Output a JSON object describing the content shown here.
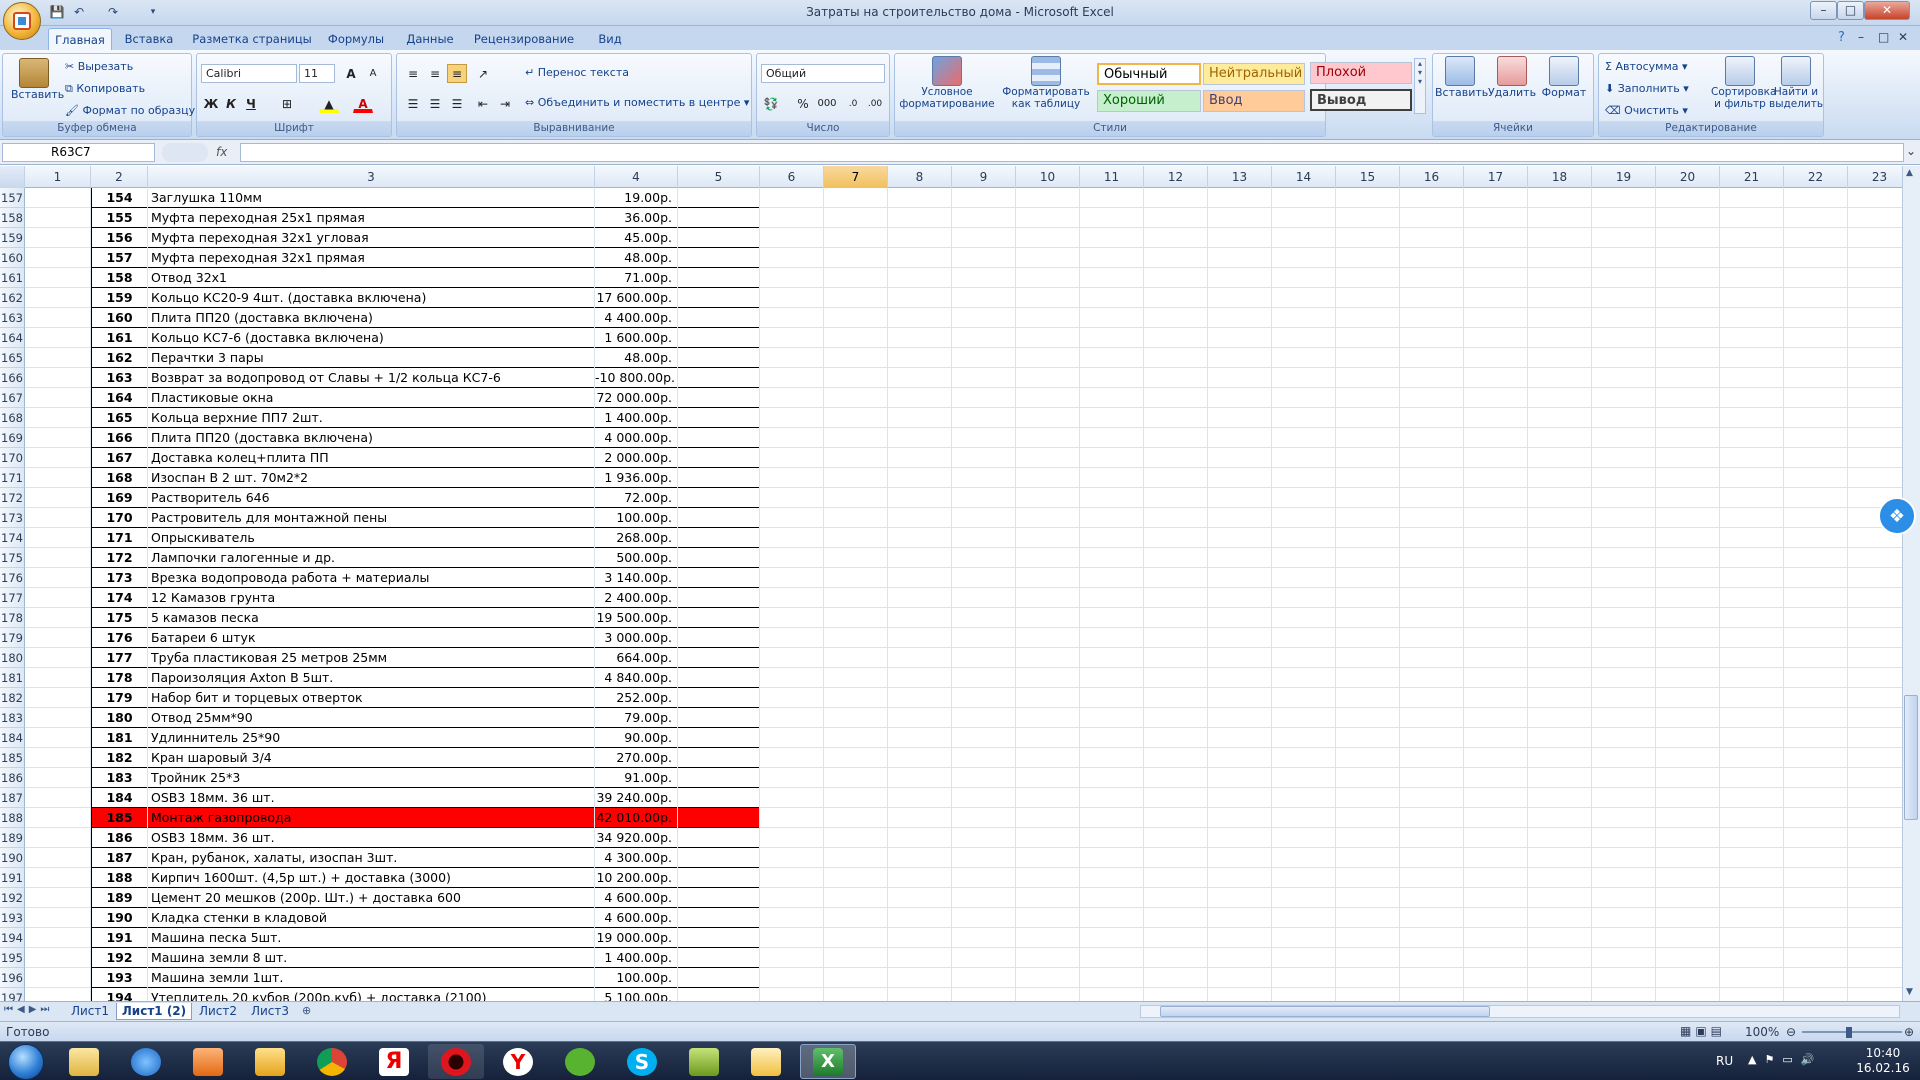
{
  "window": {
    "title": "Затраты на строительство дома - Microsoft Excel",
    "minimize": "–",
    "maximize": "□",
    "close": "✕"
  },
  "ribbon": {
    "tabs": [
      "Главная",
      "Вставка",
      "Разметка страницы",
      "Формулы",
      "Данные",
      "Рецензирование",
      "Вид"
    ],
    "active_tab": "Главная",
    "clipboard": {
      "label": "Буфер обмена",
      "paste": "Вставить",
      "cut": "Вырезать",
      "copy": "Копировать",
      "format_painter": "Формат по образцу"
    },
    "font": {
      "label": "Шрифт",
      "font_name": "Calibri",
      "font_size": "11",
      "bold": "Ж",
      "italic": "К",
      "underline": "Ч"
    },
    "alignment": {
      "label": "Выравнивание",
      "wrap_text": "Перенос текста",
      "merge_center": "Объединить и поместить в центре"
    },
    "number": {
      "label": "Число",
      "format": "Общий",
      "percent": "%",
      "thousands": "000"
    },
    "styles": {
      "label": "Стили",
      "conditional": "Условное форматирование",
      "format_table": "Форматировать как таблицу",
      "normal": "Обычный",
      "neutral": "Нейтральный",
      "bad": "Плохой",
      "good": "Хороший",
      "input": "Ввод",
      "output": "Вывод"
    },
    "cells": {
      "label": "Ячейки",
      "insert": "Вставить",
      "delete": "Удалить",
      "format": "Формат"
    },
    "editing": {
      "label": "Редактирование",
      "autosum": "Автосумма",
      "fill": "Заполнить",
      "clear": "Очистить",
      "sort_filter": "Сортировка и фильтр",
      "find_select": "Найти и выделить"
    }
  },
  "formula_bar": {
    "name_box": "R63C7",
    "fx": "fx",
    "value": ""
  },
  "columns": [
    "1",
    "2",
    "3",
    "4",
    "5",
    "6",
    "7",
    "8",
    "9",
    "10",
    "11",
    "12",
    "13",
    "14",
    "15",
    "16",
    "17",
    "18",
    "19",
    "20",
    "21",
    "22",
    "23"
  ],
  "selected_column": "7",
  "rows": [
    {
      "r": "157",
      "n": "154",
      "name": "Заглушка 110мм",
      "sum": "19.00р."
    },
    {
      "r": "158",
      "n": "155",
      "name": "Муфта переходная 25х1 прямая",
      "sum": "36.00р."
    },
    {
      "r": "159",
      "n": "156",
      "name": "Муфта переходная 32х1 угловая",
      "sum": "45.00р."
    },
    {
      "r": "160",
      "n": "157",
      "name": "Муфта переходная 32х1 прямая",
      "sum": "48.00р."
    },
    {
      "r": "161",
      "n": "158",
      "name": "Отвод 32х1",
      "sum": "71.00р."
    },
    {
      "r": "162",
      "n": "159",
      "name": "Кольцо КС20-9 4шт. (доставка включена)",
      "sum": "17 600.00р."
    },
    {
      "r": "163",
      "n": "160",
      "name": "Плита ПП20 (доставка включена)",
      "sum": "4 400.00р."
    },
    {
      "r": "164",
      "n": "161",
      "name": "Кольцо КС7-6 (доставка включена)",
      "sum": "1 600.00р."
    },
    {
      "r": "165",
      "n": "162",
      "name": "Перачтки 3 пары",
      "sum": "48.00р."
    },
    {
      "r": "166",
      "n": "163",
      "name": "Возврат за водопровод от Славы + 1/2 кольца КС7-6",
      "sum": "-10 800.00р."
    },
    {
      "r": "167",
      "n": "164",
      "name": "Пластиковые окна",
      "sum": "72 000.00р."
    },
    {
      "r": "168",
      "n": "165",
      "name": "Кольца верхние ПП7 2шт.",
      "sum": "1 400.00р."
    },
    {
      "r": "169",
      "n": "166",
      "name": "Плита ПП20 (доставка включена)",
      "sum": "4 000.00р."
    },
    {
      "r": "170",
      "n": "167",
      "name": "Доставка колец+плита ПП",
      "sum": "2 000.00р."
    },
    {
      "r": "171",
      "n": "168",
      "name": "Изоспан В 2 шт. 70м2*2",
      "sum": "1 936.00р."
    },
    {
      "r": "172",
      "n": "169",
      "name": "Растворитель 646",
      "sum": "72.00р."
    },
    {
      "r": "173",
      "n": "170",
      "name": "Растровитель для монтажной пены",
      "sum": "100.00р."
    },
    {
      "r": "174",
      "n": "171",
      "name": "Опрыскиватель",
      "sum": "268.00р."
    },
    {
      "r": "175",
      "n": "172",
      "name": "Лампочки галогенные и др.",
      "sum": "500.00р."
    },
    {
      "r": "176",
      "n": "173",
      "name": "Врезка водопровода работа + материалы",
      "sum": "3 140.00р."
    },
    {
      "r": "177",
      "n": "174",
      "name": "12 Камазов грунта",
      "sum": "2 400.00р."
    },
    {
      "r": "178",
      "n": "175",
      "name": "5 камазов песка",
      "sum": "19 500.00р."
    },
    {
      "r": "179",
      "n": "176",
      "name": "Батареи 6 штук",
      "sum": "3 000.00р."
    },
    {
      "r": "180",
      "n": "177",
      "name": "Труба пластиковая 25 метров 25мм",
      "sum": "664.00р."
    },
    {
      "r": "181",
      "n": "178",
      "name": "Пароизоляция Axton В 5шт.",
      "sum": "4 840.00р."
    },
    {
      "r": "182",
      "n": "179",
      "name": "Набор бит и торцевых отверток",
      "sum": "252.00р."
    },
    {
      "r": "183",
      "n": "180",
      "name": "Отвод 25мм*90",
      "sum": "79.00р."
    },
    {
      "r": "184",
      "n": "181",
      "name": "Удлиннитель 25*90",
      "sum": "90.00р."
    },
    {
      "r": "185",
      "n": "182",
      "name": "Кран шаровый 3/4",
      "sum": "270.00р."
    },
    {
      "r": "186",
      "n": "183",
      "name": "Тройник 25*3",
      "sum": "91.00р."
    },
    {
      "r": "187",
      "n": "184",
      "name": "OSB3 18мм. 36 шт.",
      "sum": "39 240.00р."
    },
    {
      "r": "188",
      "n": "185",
      "name": "Монтаж газопровода",
      "sum": "42 010.00р.",
      "highlight": true
    },
    {
      "r": "189",
      "n": "186",
      "name": "OSB3 18мм. 36 шт.",
      "sum": "34 920.00р."
    },
    {
      "r": "190",
      "n": "187",
      "name": "Кран, рубанок, халаты, изоспан 3шт.",
      "sum": "4 300.00р."
    },
    {
      "r": "191",
      "n": "188",
      "name": "Кирпич 1600шт. (4,5р шт.) + доставка (3000)",
      "sum": "10 200.00р."
    },
    {
      "r": "192",
      "n": "189",
      "name": "Цемент 20 мешков (200р. Шт.) + доставка 600",
      "sum": "4 600.00р."
    },
    {
      "r": "193",
      "n": "190",
      "name": "Кладка стенки в кладовой",
      "sum": "4 600.00р."
    },
    {
      "r": "194",
      "n": "191",
      "name": "Машина песка 5шт.",
      "sum": "19 000.00р."
    },
    {
      "r": "195",
      "n": "192",
      "name": "Машина земли 8 шт.",
      "sum": "1 400.00р."
    },
    {
      "r": "196",
      "n": "193",
      "name": "Машина земли 1шт.",
      "sum": "100.00р."
    },
    {
      "r": "197",
      "n": "194",
      "name": "Утеплитель 20 кубов (200р.куб) + доставка (2100)",
      "sum": "5 100.00р."
    }
  ],
  "sheets": [
    "Лист1",
    "Лист1 (2)",
    "Лист2",
    "Лист3"
  ],
  "active_sheet": "Лист1 (2)",
  "status": {
    "ready": "Готово",
    "zoom": "100%"
  },
  "taskbar": {
    "lang": "RU",
    "time": "10:40",
    "date": "16.02.16"
  },
  "colors": {
    "highlight": "#ff0000",
    "selected_col": "#f1c05c",
    "ribbon": "#dbe6f4"
  }
}
